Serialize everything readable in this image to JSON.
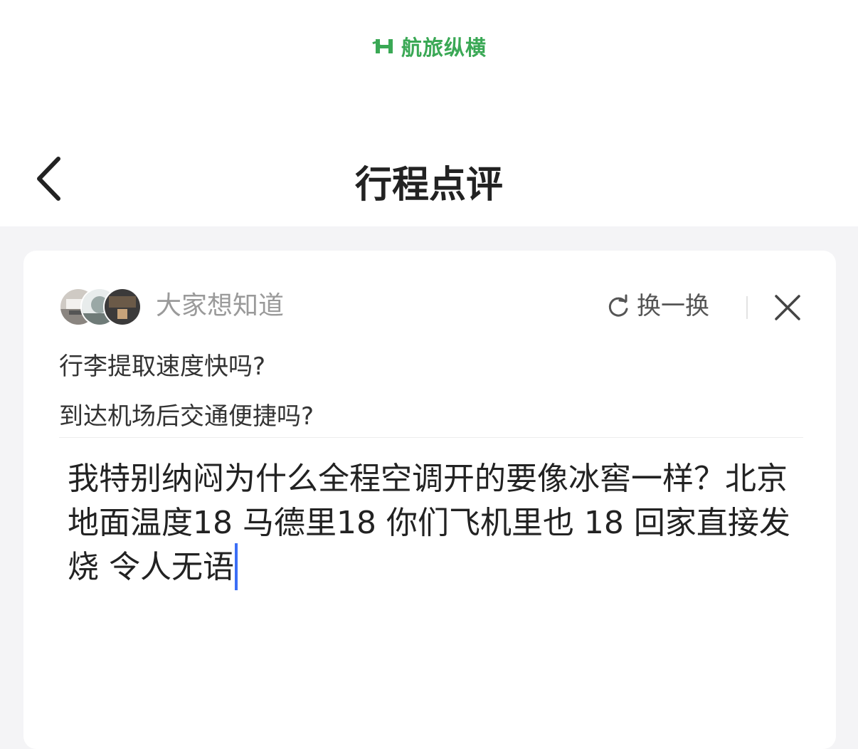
{
  "brand": {
    "name": "航旅纵横",
    "color": "#3aa855"
  },
  "nav": {
    "back_icon": "chevron-left-icon",
    "title": "行程点评"
  },
  "suggestions": {
    "label": "大家想知道",
    "refresh_label": "换一换",
    "refresh_icon": "refresh-icon",
    "close_icon": "close-icon",
    "questions": [
      "行李提取速度快吗?",
      "到达机场后交通便捷吗?"
    ]
  },
  "review": {
    "text": "我特别纳闷为什么全程空调开的要像冰窖一样？北京地面温度18 马德里18 你们飞机里也 18 回家直接发烧  令人无语",
    "caret_color": "#3b6ef5"
  }
}
